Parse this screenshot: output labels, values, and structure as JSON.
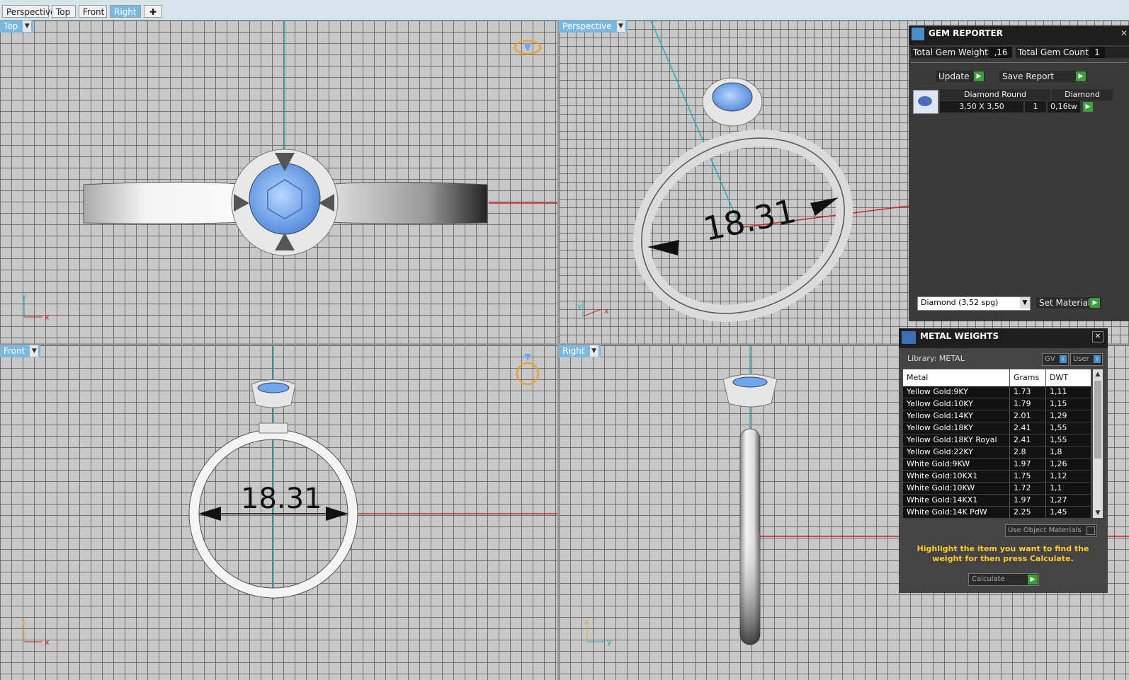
{
  "tabs": [
    "Perspective",
    "Top",
    "Front",
    "Right"
  ],
  "viewports": {
    "top": {
      "label": "Top"
    },
    "perspective": {
      "label": "Perspective",
      "dimension": "18.31"
    },
    "front": {
      "label": "Front",
      "dimension": "18.31"
    },
    "right": {
      "label": "Right"
    }
  },
  "axes": {
    "x": "x",
    "y": "y"
  },
  "gem_reporter": {
    "title": "GEM REPORTER",
    "total_gem_weight_label": "Total Gem Weight",
    "total_gem_weight": ",16",
    "total_gem_count_label": "Total Gem Count",
    "total_gem_count": "1",
    "update_label": "Update",
    "save_report_label": "Save Report",
    "gem_name": "Diamond Round",
    "gem_type": "Diamond",
    "gem_size": "3,50 X 3,50",
    "gem_qty": "1",
    "gem_weight": "0,16tw",
    "material_select": "Diamond    (3,52 spg)",
    "set_material_label": "Set Material"
  },
  "metal_weights": {
    "title": "METAL WEIGHTS",
    "library_label": "Library: METAL",
    "gv_label": "GV",
    "user_label": "User",
    "columns": [
      "Metal",
      "Grams",
      "DWT"
    ],
    "rows": [
      [
        "Yellow Gold:9KY",
        "1.73",
        "1,11"
      ],
      [
        "Yellow Gold:10KY",
        "1.79",
        "1,15"
      ],
      [
        "Yellow Gold:14KY",
        "2.01",
        "1,29"
      ],
      [
        "Yellow Gold:18KY",
        "2.41",
        "1,55"
      ],
      [
        "Yellow Gold:18KY Royal",
        "2.41",
        "1,55"
      ],
      [
        "Yellow Gold:22KY",
        "2.8",
        "1,8"
      ],
      [
        "White Gold:9KW",
        "1.97",
        "1,26"
      ],
      [
        "White Gold:10KX1",
        "1.75",
        "1,12"
      ],
      [
        "White Gold:10KW",
        "1.72",
        "1,1"
      ],
      [
        "White Gold:14KX1",
        "1.97",
        "1,27"
      ],
      [
        "White Gold:14K PdW",
        "2.25",
        "1,45"
      ]
    ],
    "use_object_materials_label": "Use Object Materials",
    "hint": "Highlight the item you want to find the weight for then press Calculate.",
    "calculate_label": "Calculate"
  },
  "colors": {
    "accent": "#7bb8e0",
    "gem": "#6fa6ef",
    "axis_red": "#cc2222",
    "axis_cyan": "#2aa8b8",
    "hint": "#ffcc33"
  }
}
